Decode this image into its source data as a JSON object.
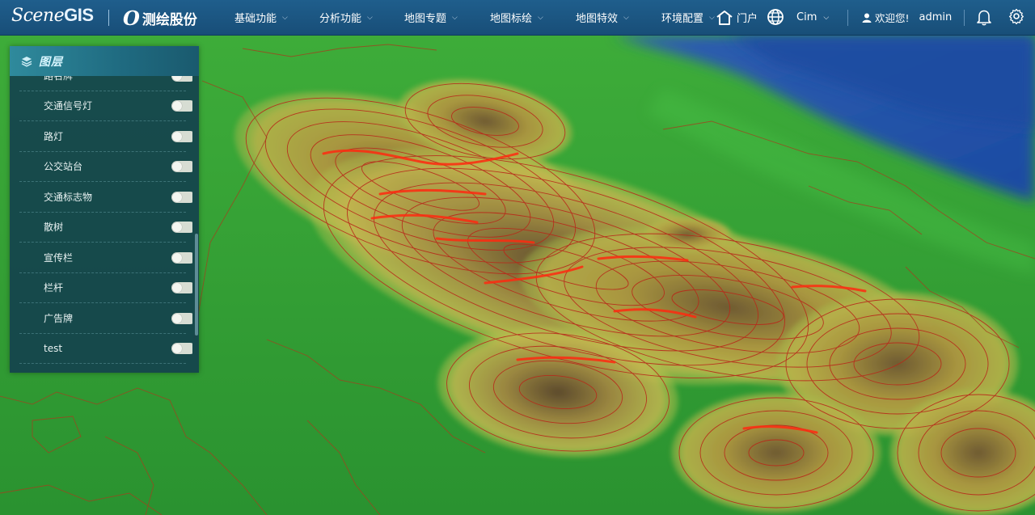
{
  "header": {
    "logo_scene": "Scene",
    "logo_gis": "GIS",
    "company_mark": "O",
    "company_name": "测绘股份",
    "nav": [
      {
        "label": "基础功能"
      },
      {
        "label": "分析功能"
      },
      {
        "label": "地图专题"
      },
      {
        "label": "地图标绘"
      },
      {
        "label": "地图特效"
      },
      {
        "label": "环境配置"
      }
    ],
    "portal_label": "门户",
    "scene_selector": "Cim",
    "welcome": "欢迎您!",
    "username": "admin"
  },
  "layer_panel": {
    "title": "图层",
    "items": [
      {
        "label": "路名牌",
        "enabled": false
      },
      {
        "label": "交通信号灯",
        "enabled": false
      },
      {
        "label": "路灯",
        "enabled": false
      },
      {
        "label": "公交站台",
        "enabled": false
      },
      {
        "label": "交通标志物",
        "enabled": false
      },
      {
        "label": "散树",
        "enabled": false
      },
      {
        "label": "宣传栏",
        "enabled": false
      },
      {
        "label": "栏杆",
        "enabled": false
      },
      {
        "label": "广告牌",
        "enabled": false
      },
      {
        "label": "test",
        "enabled": false
      },
      {
        "label": "",
        "enabled": false
      }
    ]
  },
  "colors": {
    "topbar": "#1f5e8c",
    "panel": "#123e4e",
    "terrain_low": "#2e9a33",
    "terrain_high": "#8a7a3a",
    "contour": "#c8261a",
    "water": "#1f4fa0"
  },
  "icons": [
    "home-icon",
    "globe-icon",
    "user-icon",
    "bell-icon",
    "gear-icon",
    "layers-icon",
    "chevron-down-icon"
  ]
}
